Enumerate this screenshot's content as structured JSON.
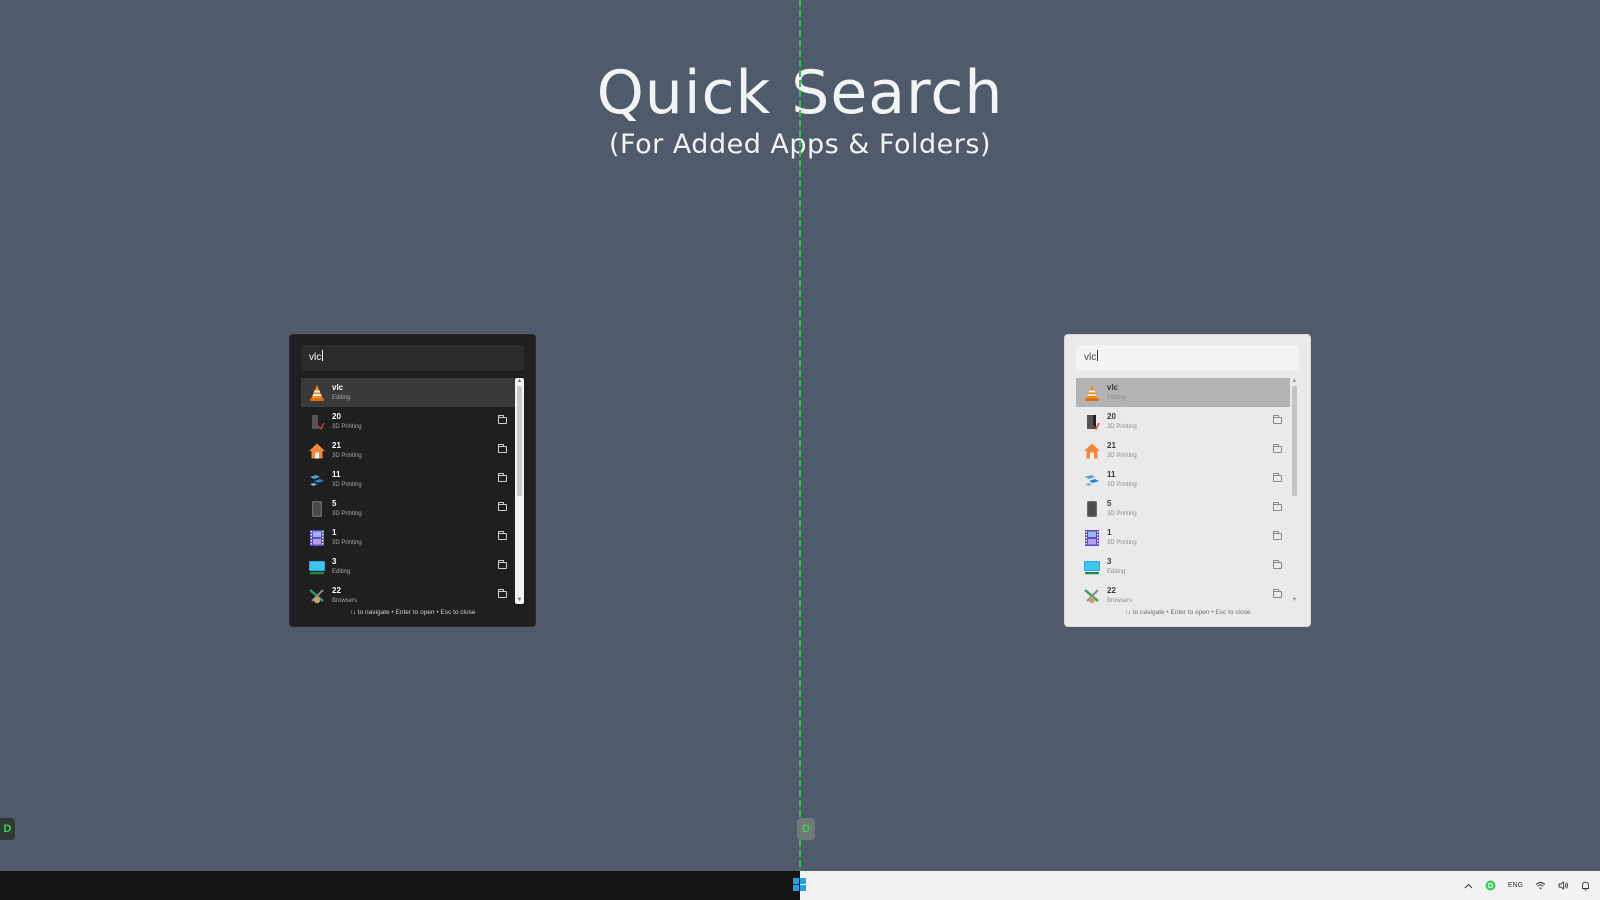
{
  "heading": {
    "title": "Quick Search",
    "subtitle": "(For Added Apps & Folders)"
  },
  "panels": [
    {
      "theme": "dark",
      "search_value": "vlc",
      "hint": "↑↓ to navigate • Enter to open • Esc to close",
      "items": [
        {
          "name": "vlc",
          "category": "Editing",
          "icon": "vlc-cone-icon",
          "selected": true,
          "folder": false
        },
        {
          "name": "20",
          "category": "3D Printing",
          "icon": "tower-icon",
          "selected": false,
          "folder": true
        },
        {
          "name": "21",
          "category": "3D Printing",
          "icon": "house-icon",
          "selected": false,
          "folder": true
        },
        {
          "name": "11",
          "category": "3D Printing",
          "icon": "blocks-icon",
          "selected": false,
          "folder": true
        },
        {
          "name": "5",
          "category": "3D Printing",
          "icon": "phone-icon",
          "selected": false,
          "folder": true
        },
        {
          "name": "1",
          "category": "3D Printing",
          "icon": "film-icon",
          "selected": false,
          "folder": true
        },
        {
          "name": "3",
          "category": "Editing",
          "icon": "monitor-icon",
          "selected": false,
          "folder": true
        },
        {
          "name": "22",
          "category": "Browsers",
          "icon": "tools-icon",
          "selected": false,
          "folder": true
        }
      ]
    },
    {
      "theme": "light",
      "search_value": "vlc",
      "hint": "↑↓ to navigate • Enter to open • Esc to close",
      "items": [
        {
          "name": "vlc",
          "category": "Editing",
          "icon": "vlc-cone-icon",
          "selected": true,
          "folder": false
        },
        {
          "name": "20",
          "category": "3D Printing",
          "icon": "tower-icon",
          "selected": false,
          "folder": true
        },
        {
          "name": "21",
          "category": "3D Printing",
          "icon": "house-icon",
          "selected": false,
          "folder": true
        },
        {
          "name": "11",
          "category": "3D Printing",
          "icon": "blocks-icon",
          "selected": false,
          "folder": true
        },
        {
          "name": "5",
          "category": "3D Printing",
          "icon": "phone-icon",
          "selected": false,
          "folder": true
        },
        {
          "name": "1",
          "category": "3D Printing",
          "icon": "film-icon",
          "selected": false,
          "folder": true
        },
        {
          "name": "3",
          "category": "Editing",
          "icon": "monitor-icon",
          "selected": false,
          "folder": true
        },
        {
          "name": "22",
          "category": "Browsers",
          "icon": "tools-icon",
          "selected": false,
          "folder": true
        }
      ]
    }
  ],
  "taskbar": {
    "language": "ENG",
    "tray_icons": [
      "chevron-up-icon",
      "app-tray-icon",
      "wifi-icon",
      "volume-icon",
      "bell-icon"
    ]
  },
  "colors": {
    "background": "#4f5b6a",
    "divider": "#2fc24a",
    "accent_green": "#3bd05a",
    "windows_blue": "#25a0e6"
  }
}
